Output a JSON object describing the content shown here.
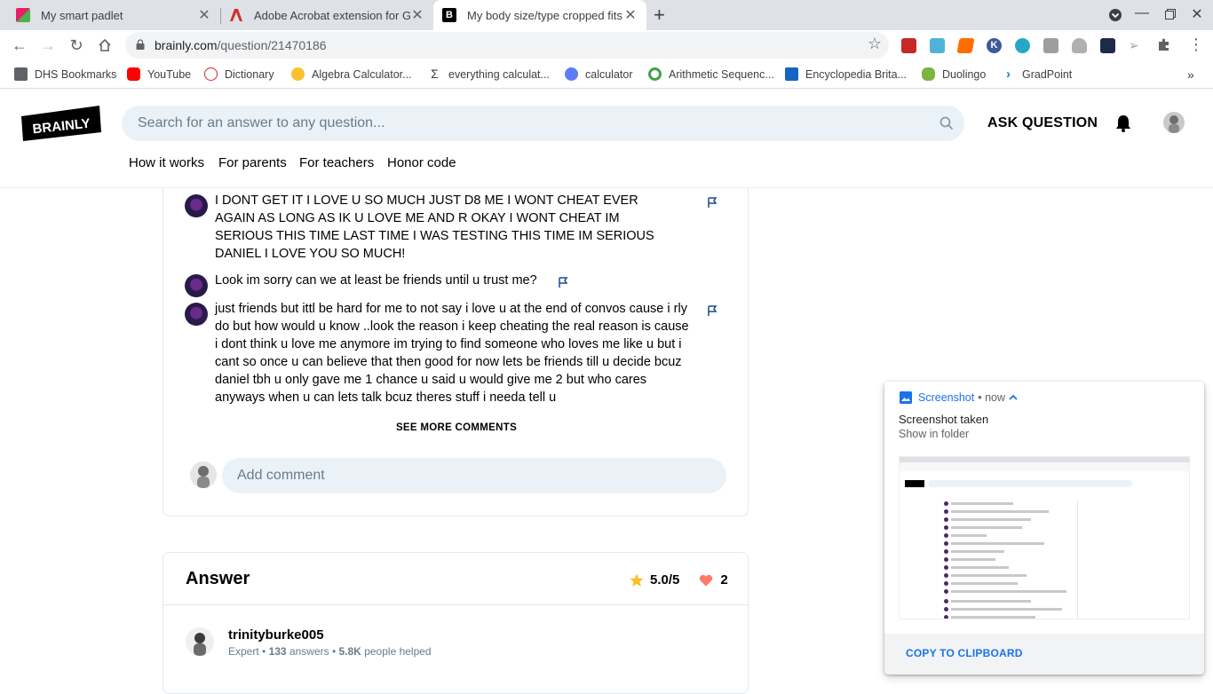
{
  "browser": {
    "tabs": [
      {
        "title": "My smart padlet",
        "active": false
      },
      {
        "title": "Adobe Acrobat extension for Go",
        "active": false
      },
      {
        "title": "My body size/type cropped fits T",
        "active": true
      }
    ],
    "url_host": "brainly.com",
    "url_path": "/question/21470186",
    "bookmarks": [
      "DHS Bookmarks",
      "YouTube",
      "Dictionary",
      "Algebra Calculator...",
      "everything calculat...",
      "calculator",
      "Arithmetic Sequenc...",
      "Encyclopedia Brita...",
      "Duolingo",
      "GradPoint"
    ]
  },
  "header": {
    "logo": "BRAINLY",
    "search_placeholder": "Search for an answer to any question...",
    "ask_question": "ASK QUESTION",
    "nav": [
      "How it works",
      "For parents",
      "For teachers",
      "Honor code"
    ]
  },
  "comments": [
    {
      "text": "I DONT GET IT I LOVE U SO MUCH JUST D8 ME I WONT CHEAT EVER AGAIN AS LONG AS IK U LOVE ME AND R OKAY I WONT CHEAT IM SERIOUS THIS TIME LAST TIME I WAS TESTING THIS TIME IM SERIOUS DANIEL I LOVE YOU SO MUCH!"
    },
    {
      "text": "Look im sorry can we at least be friends until u trust me?"
    },
    {
      "text": "just friends but ittl be hard for me to not say i love u at the end of convos cause i rly do but how would u know ..look the reason i keep cheating the real reason is cause i dont think u love me anymore im trying to find someone who loves me like u but i cant so once u can believe that then good for now lets be friends till u decide bcuz daniel tbh u only gave me 1 chance u said u would give me 2 but who cares anyways when u can lets talk bcuz theres stuff i needa tell u"
    }
  ],
  "see_more": "SEE MORE COMMENTS",
  "add_comment_placeholder": "Add comment",
  "answer": {
    "title": "Answer",
    "rating": "5.0/5",
    "thanks": "2",
    "username": "trinityburke005",
    "rank": "Expert",
    "answers_count": "133",
    "answers_label": "answers",
    "helped_count": "5.8K",
    "helped_label": "people helped"
  },
  "notification": {
    "app": "Screenshot",
    "time": "now",
    "title": "Screenshot taken",
    "subtitle": "Show in folder",
    "action": "COPY TO CLIPBOARD"
  },
  "colors": {
    "brand": "#000000",
    "search_bg": "#ebf2f7",
    "chrome_tabbar": "#dee1e6",
    "link_blue": "#1a73e8",
    "star": "#fbbe2e",
    "heart": "#ff7968"
  }
}
